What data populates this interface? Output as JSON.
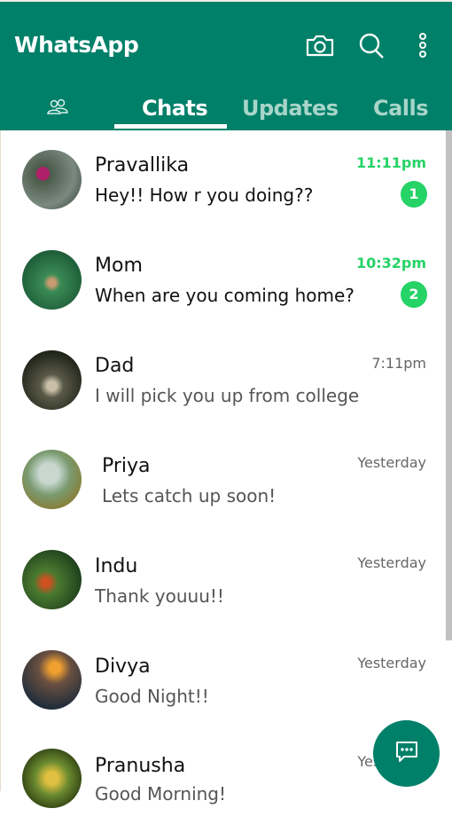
{
  "header": {
    "title": "WhatsApp",
    "icons": [
      "camera-icon",
      "search-icon",
      "more-vert-icon"
    ]
  },
  "tabs": [
    {
      "label": "Chats",
      "active": true
    },
    {
      "label": "Updates"
    },
    {
      "label": "Calls"
    }
  ],
  "chats": [
    {
      "name": "Pravallika",
      "message": "Hey!! How r you doing??",
      "time": "11:11pm",
      "unread": "1"
    },
    {
      "name": "Mom",
      "message": "When are you coming home?",
      "time": "10:32pm",
      "unread": "2"
    },
    {
      "name": "Dad",
      "message": "I will pick you up from college",
      "time": "7:11pm"
    },
    {
      "name": "Priya",
      "message": "Lets catch up soon!",
      "time": "Yesterday"
    },
    {
      "name": "Indu",
      "message": "Thank youuu!!",
      "time": "Yesterday"
    },
    {
      "name": "Divya",
      "message": "Good Night!!",
      "time": "Yesterday"
    },
    {
      "name": "Pranusha",
      "message": "Good Morning!",
      "time": "Yesterday"
    }
  ],
  "colors": {
    "brand": "#008069",
    "unread": "#25d366"
  }
}
